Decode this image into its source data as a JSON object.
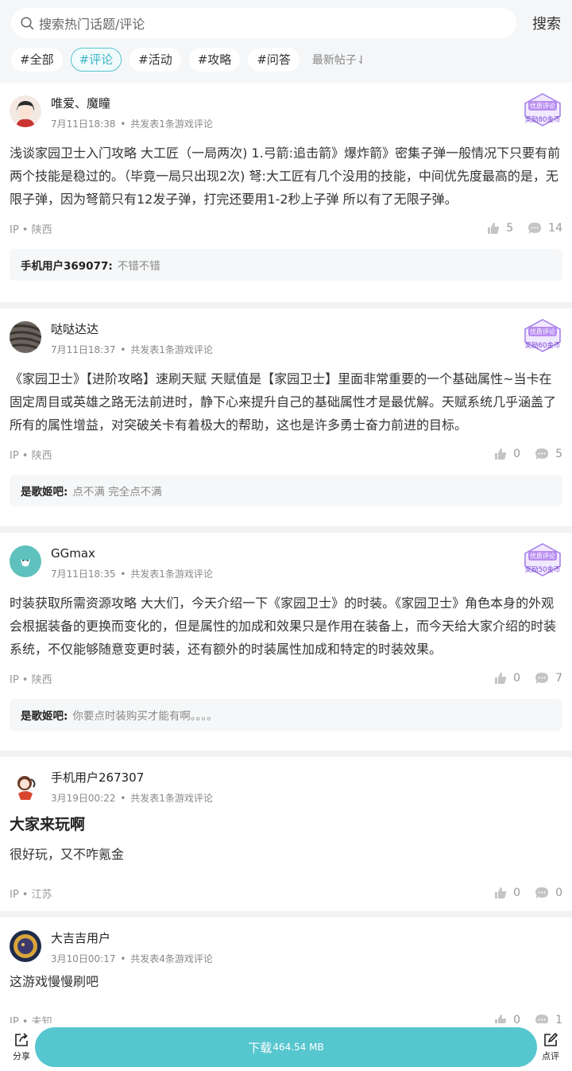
{
  "search": {
    "placeholder": "搜索热门话题/评论",
    "button": "搜索"
  },
  "tags": [
    "#全部",
    "#评论",
    "#活动",
    "#攻略",
    "#问答"
  ],
  "active_tag_index": 1,
  "sort_label": "最新帖子⇃",
  "posts": [
    {
      "author": "唯爱、魔瞳",
      "time": "7月11日18:38",
      "meta": "共发表1条游戏评论",
      "badge_title": "优质评论",
      "badge_reward": "奖励80金币",
      "title": "",
      "body": "浅谈家园卫士入门攻略 大工匠（一局两次) 1.弓箭:追击箭》爆炸箭》密集子弹一般情况下只要有前两个技能是稳过的。（毕竟一局只出现2次) 弩:大工匠有几个没用的技能，中间优先度最高的是，无限子弹，因为弩箭只有12发子弹，打完还要用1-2秒上子弹 所以有了无限子弹。",
      "ip": "IP • 陕西",
      "likes": "5",
      "comments": "14",
      "reply_user": "手机用户369077:",
      "reply_text": "不错不错"
    },
    {
      "author": "哒哒达达",
      "time": "7月11日18:37",
      "meta": "共发表1条游戏评论",
      "badge_title": "优质评论",
      "badge_reward": "奖励60金币",
      "title": "",
      "body": "《家园卫士》【进阶攻略】速刷天赋 天赋值是【家园卫士】里面非常重要的一个基础属性~当卡在固定周目或英雄之路无法前进时，静下心来提升自己的基础属性才是最优解。天赋系统几乎涵盖了所有的属性增益，对突破关卡有着极大的帮助，这也是许多勇士奋力前进的目标。",
      "ip": "IP • 陕西",
      "likes": "0",
      "comments": "5",
      "reply_user": "是歌姬吧:",
      "reply_text": "点不满 完全点不满"
    },
    {
      "author": "GGmax",
      "time": "7月11日18:35",
      "meta": "共发表1条游戏评论",
      "badge_title": "优质评论",
      "badge_reward": "奖励50金币",
      "title": "",
      "body": "时装获取所需资源攻略 大大们，今天介绍一下《家园卫士》的时装。《家园卫士》角色本身的外观会根据装备的更换而变化的，但是属性的加成和效果只是作用在装备上，而今天给大家介绍的时装系统，不仅能够随意变更时装，还有额外的时装属性加成和特定的时装效果。",
      "ip": "IP • 陕西",
      "likes": "0",
      "comments": "7",
      "reply_user": "是歌姬吧:",
      "reply_text": "你要点时装购买才能有啊。。。。"
    },
    {
      "author": "手机用户267307",
      "time": "3月19日00:22",
      "meta": "共发表1条游戏评论",
      "title": "大家来玩啊",
      "body": "很好玩，又不咋氪金",
      "ip": "IP • 江苏",
      "likes": "0",
      "comments": "0"
    },
    {
      "author": "大吉吉用户",
      "time": "3月10日00:17",
      "meta": "共发表4条游戏评论",
      "title": "",
      "body": "这游戏慢慢刷吧",
      "ip": "IP • 未知",
      "likes": "0",
      "comments": "1"
    }
  ],
  "bottom": {
    "share": "分享",
    "download": "下载",
    "size": "464.54 MB",
    "review": "点评"
  },
  "colors": {
    "accent": "#56c6cf",
    "badge": "#8f5fe0"
  }
}
